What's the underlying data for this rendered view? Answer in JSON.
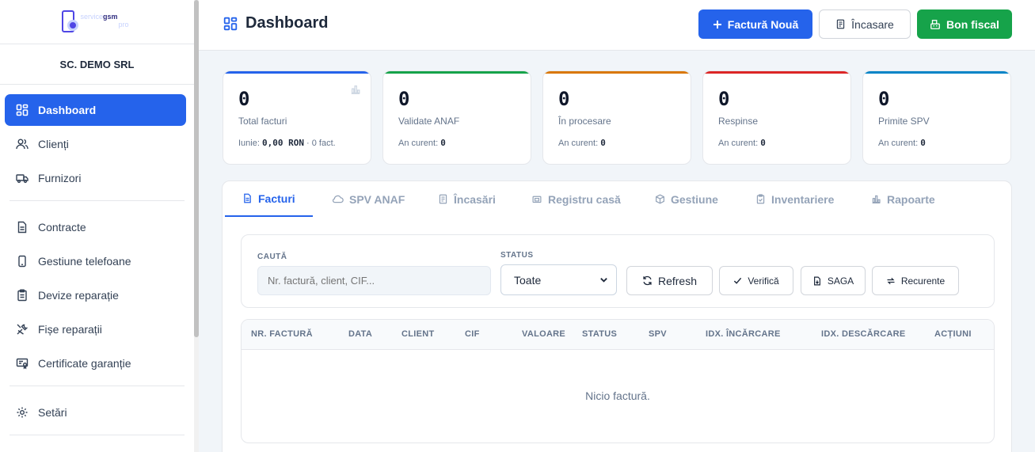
{
  "brand": {
    "logo_text": "service",
    "logo_strong": "gsm",
    "logo_sub": "pro",
    "company": "SC. DEMO SRL"
  },
  "sidebar": {
    "items": [
      {
        "label": "Dashboard",
        "icon": "dashboard-grid-icon",
        "active": true
      },
      {
        "label": "Clienți",
        "icon": "users-icon"
      },
      {
        "label": "Furnizori",
        "icon": "truck-icon"
      },
      {
        "label": "Contracte",
        "icon": "document-icon"
      },
      {
        "label": "Gestiune telefoane",
        "icon": "phone-icon"
      },
      {
        "label": "Devize reparație",
        "icon": "clipboard-icon"
      },
      {
        "label": "Fișe reparații",
        "icon": "tools-icon"
      },
      {
        "label": "Certificate garanție",
        "icon": "certificate-icon"
      },
      {
        "label": "Setări",
        "icon": "gear-icon"
      }
    ]
  },
  "header": {
    "title": "Dashboard",
    "btn_new": "Factură Nouă",
    "btn_incasare": "Încasare",
    "btn_bon": "Bon fiscal"
  },
  "stats": [
    {
      "value": "0",
      "label": "Total facturi",
      "sub_prefix": "Iunie:",
      "sub_bold": "0,00 RON",
      "sub_suffix": "· 0 fact.",
      "color": "#2563eb"
    },
    {
      "value": "0",
      "label": "Validate ANAF",
      "sub_prefix": "An curent:",
      "sub_bold": "0",
      "sub_suffix": "",
      "color": "#16a34a"
    },
    {
      "value": "0",
      "label": "În procesare",
      "sub_prefix": "An curent:",
      "sub_bold": "0",
      "sub_suffix": "",
      "color": "#d97706"
    },
    {
      "value": "0",
      "label": "Respinse",
      "sub_prefix": "An curent:",
      "sub_bold": "0",
      "sub_suffix": "",
      "color": "#dc2626"
    },
    {
      "value": "0",
      "label": "Primite SPV",
      "sub_prefix": "An curent:",
      "sub_bold": "0",
      "sub_suffix": "",
      "color": "#0284c7"
    }
  ],
  "tabs": [
    {
      "label": "Facturi",
      "icon": "file-icon",
      "active": true
    },
    {
      "label": "SPV ANAF",
      "icon": "cloud-icon"
    },
    {
      "label": "Încasări",
      "icon": "receipt-icon"
    },
    {
      "label": "Registru casă",
      "icon": "cash-register-icon"
    },
    {
      "label": "Gestiune",
      "icon": "box-icon"
    },
    {
      "label": "Inventariere",
      "icon": "clipboard-check-icon"
    },
    {
      "label": "Rapoarte",
      "icon": "bar-chart-icon"
    }
  ],
  "filters": {
    "search_label": "CAUTĂ",
    "search_placeholder": "Nr. factură, client, CIF...",
    "status_label": "STATUS",
    "status_value": "Toate",
    "btn_refresh": "Refresh",
    "btn_verifica": "Verifică",
    "btn_saga": "SAGA",
    "btn_recurente": "Recurente"
  },
  "table": {
    "columns": [
      "NR. FACTURĂ",
      "DATA",
      "CLIENT",
      "CIF",
      "VALOARE",
      "STATUS",
      "SPV",
      "IDX. ÎNCĂRCARE",
      "IDX. DESCĂRCARE",
      "ACȚIUNI"
    ],
    "empty_text": "Nicio factură."
  }
}
